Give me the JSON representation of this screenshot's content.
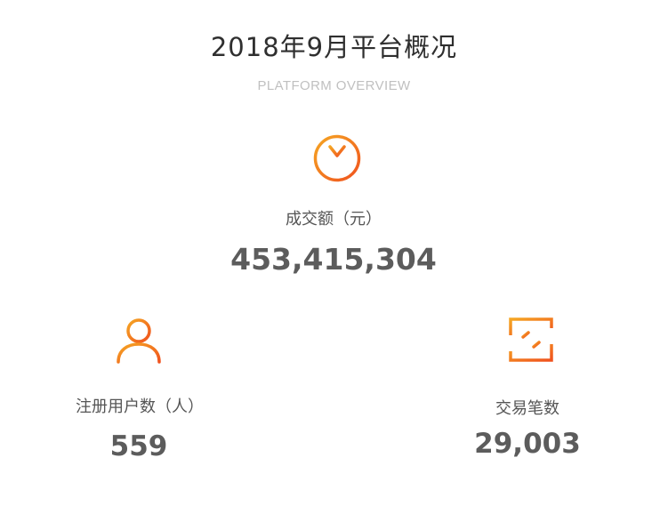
{
  "header": {
    "title": "2018年9月平台概况",
    "subtitle": "PLATFORM OVERVIEW"
  },
  "stats": {
    "turnover": {
      "icon": "yuan-coin-icon",
      "label": "成交额（元）",
      "value": "453,415,304"
    },
    "registered_users": {
      "icon": "user-icon",
      "label": "注册用户数（人）",
      "value": "559"
    },
    "transactions": {
      "icon": "exchange-icon",
      "label": "交易笔数",
      "value": "29,003"
    }
  },
  "colors": {
    "accent_start": "#f5a623",
    "accent_end": "#f0521e",
    "title": "#2f2f2f",
    "subtitle": "#c0c0c0",
    "label": "#555555",
    "value": "#5c5c5c"
  }
}
